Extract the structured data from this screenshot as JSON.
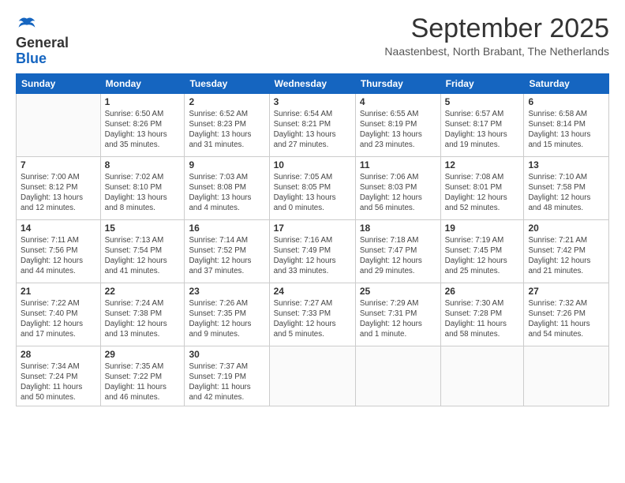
{
  "logo": {
    "general": "General",
    "blue": "Blue"
  },
  "header": {
    "title": "September 2025",
    "subtitle": "Naastenbest, North Brabant, The Netherlands"
  },
  "weekdays": [
    "Sunday",
    "Monday",
    "Tuesday",
    "Wednesday",
    "Thursday",
    "Friday",
    "Saturday"
  ],
  "weeks": [
    [
      {
        "date": "",
        "info": ""
      },
      {
        "date": "1",
        "info": "Sunrise: 6:50 AM\nSunset: 8:26 PM\nDaylight: 13 hours\nand 35 minutes."
      },
      {
        "date": "2",
        "info": "Sunrise: 6:52 AM\nSunset: 8:23 PM\nDaylight: 13 hours\nand 31 minutes."
      },
      {
        "date": "3",
        "info": "Sunrise: 6:54 AM\nSunset: 8:21 PM\nDaylight: 13 hours\nand 27 minutes."
      },
      {
        "date": "4",
        "info": "Sunrise: 6:55 AM\nSunset: 8:19 PM\nDaylight: 13 hours\nand 23 minutes."
      },
      {
        "date": "5",
        "info": "Sunrise: 6:57 AM\nSunset: 8:17 PM\nDaylight: 13 hours\nand 19 minutes."
      },
      {
        "date": "6",
        "info": "Sunrise: 6:58 AM\nSunset: 8:14 PM\nDaylight: 13 hours\nand 15 minutes."
      }
    ],
    [
      {
        "date": "7",
        "info": "Sunrise: 7:00 AM\nSunset: 8:12 PM\nDaylight: 13 hours\nand 12 minutes."
      },
      {
        "date": "8",
        "info": "Sunrise: 7:02 AM\nSunset: 8:10 PM\nDaylight: 13 hours\nand 8 minutes."
      },
      {
        "date": "9",
        "info": "Sunrise: 7:03 AM\nSunset: 8:08 PM\nDaylight: 13 hours\nand 4 minutes."
      },
      {
        "date": "10",
        "info": "Sunrise: 7:05 AM\nSunset: 8:05 PM\nDaylight: 13 hours\nand 0 minutes."
      },
      {
        "date": "11",
        "info": "Sunrise: 7:06 AM\nSunset: 8:03 PM\nDaylight: 12 hours\nand 56 minutes."
      },
      {
        "date": "12",
        "info": "Sunrise: 7:08 AM\nSunset: 8:01 PM\nDaylight: 12 hours\nand 52 minutes."
      },
      {
        "date": "13",
        "info": "Sunrise: 7:10 AM\nSunset: 7:58 PM\nDaylight: 12 hours\nand 48 minutes."
      }
    ],
    [
      {
        "date": "14",
        "info": "Sunrise: 7:11 AM\nSunset: 7:56 PM\nDaylight: 12 hours\nand 44 minutes."
      },
      {
        "date": "15",
        "info": "Sunrise: 7:13 AM\nSunset: 7:54 PM\nDaylight: 12 hours\nand 41 minutes."
      },
      {
        "date": "16",
        "info": "Sunrise: 7:14 AM\nSunset: 7:52 PM\nDaylight: 12 hours\nand 37 minutes."
      },
      {
        "date": "17",
        "info": "Sunrise: 7:16 AM\nSunset: 7:49 PM\nDaylight: 12 hours\nand 33 minutes."
      },
      {
        "date": "18",
        "info": "Sunrise: 7:18 AM\nSunset: 7:47 PM\nDaylight: 12 hours\nand 29 minutes."
      },
      {
        "date": "19",
        "info": "Sunrise: 7:19 AM\nSunset: 7:45 PM\nDaylight: 12 hours\nand 25 minutes."
      },
      {
        "date": "20",
        "info": "Sunrise: 7:21 AM\nSunset: 7:42 PM\nDaylight: 12 hours\nand 21 minutes."
      }
    ],
    [
      {
        "date": "21",
        "info": "Sunrise: 7:22 AM\nSunset: 7:40 PM\nDaylight: 12 hours\nand 17 minutes."
      },
      {
        "date": "22",
        "info": "Sunrise: 7:24 AM\nSunset: 7:38 PM\nDaylight: 12 hours\nand 13 minutes."
      },
      {
        "date": "23",
        "info": "Sunrise: 7:26 AM\nSunset: 7:35 PM\nDaylight: 12 hours\nand 9 minutes."
      },
      {
        "date": "24",
        "info": "Sunrise: 7:27 AM\nSunset: 7:33 PM\nDaylight: 12 hours\nand 5 minutes."
      },
      {
        "date": "25",
        "info": "Sunrise: 7:29 AM\nSunset: 7:31 PM\nDaylight: 12 hours\nand 1 minute."
      },
      {
        "date": "26",
        "info": "Sunrise: 7:30 AM\nSunset: 7:28 PM\nDaylight: 11 hours\nand 58 minutes."
      },
      {
        "date": "27",
        "info": "Sunrise: 7:32 AM\nSunset: 7:26 PM\nDaylight: 11 hours\nand 54 minutes."
      }
    ],
    [
      {
        "date": "28",
        "info": "Sunrise: 7:34 AM\nSunset: 7:24 PM\nDaylight: 11 hours\nand 50 minutes."
      },
      {
        "date": "29",
        "info": "Sunrise: 7:35 AM\nSunset: 7:22 PM\nDaylight: 11 hours\nand 46 minutes."
      },
      {
        "date": "30",
        "info": "Sunrise: 7:37 AM\nSunset: 7:19 PM\nDaylight: 11 hours\nand 42 minutes."
      },
      {
        "date": "",
        "info": ""
      },
      {
        "date": "",
        "info": ""
      },
      {
        "date": "",
        "info": ""
      },
      {
        "date": "",
        "info": ""
      }
    ]
  ]
}
